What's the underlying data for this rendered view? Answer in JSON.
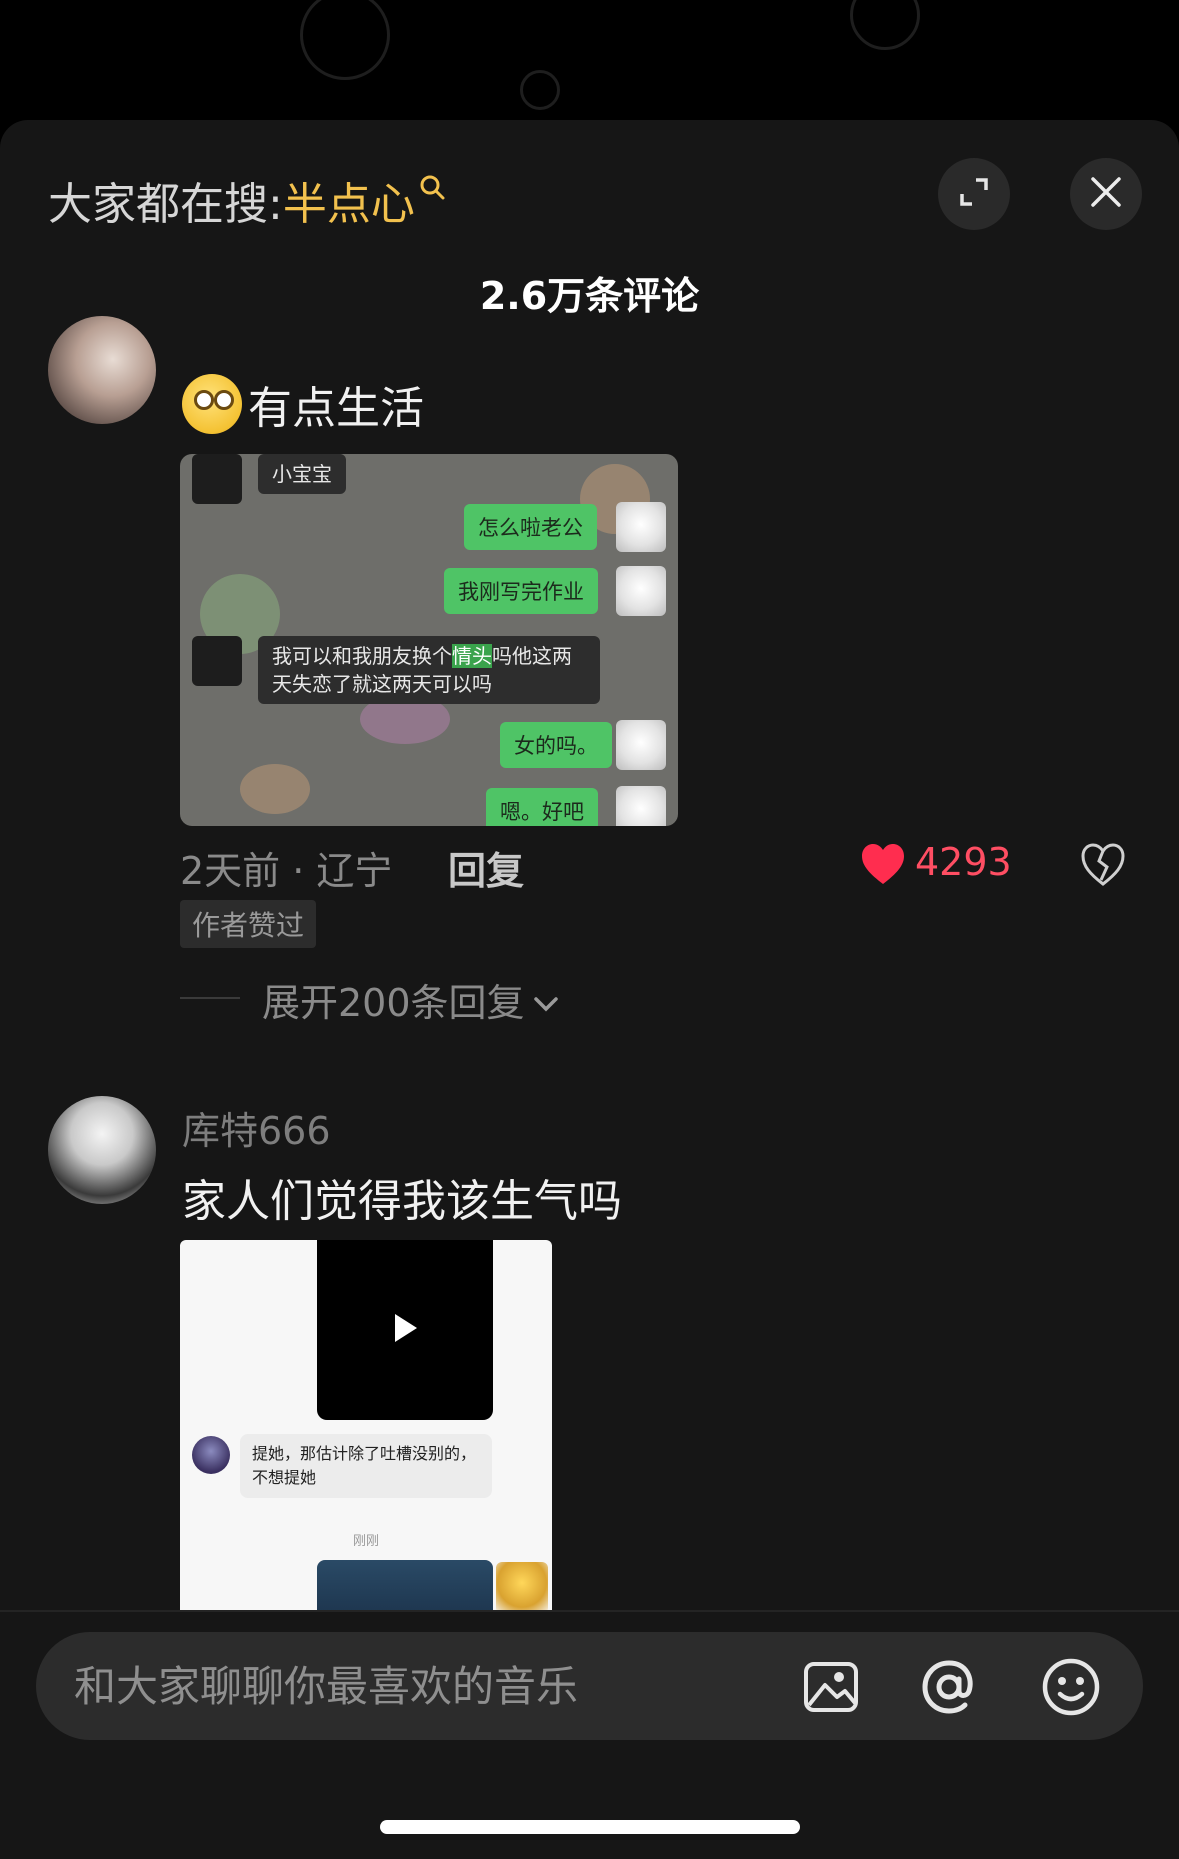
{
  "header": {
    "search_prefix": "大家都在搜:",
    "search_keyword": "半点心",
    "comment_count": "2.6万条评论"
  },
  "icons": {
    "search": "search-icon",
    "expand": "expand-icon",
    "close": "close-icon",
    "heart": "heart-icon",
    "dislike": "broken-heart-icon",
    "chevron": "chevron-down-icon",
    "image": "image-icon",
    "at": "@",
    "emoji": "emoji-icon"
  },
  "colors": {
    "keyword": "#f2c14e",
    "like": "#ff4e63",
    "chat_green": "#4fc466"
  },
  "comment1": {
    "text": "有点生活",
    "screenshot": {
      "contact_name": "小宝宝",
      "messages": [
        {
          "side": "right",
          "text": "怎么啦老公"
        },
        {
          "side": "right",
          "text": "我刚写完作业"
        },
        {
          "side": "left",
          "text_before": "我可以和我朋友换个",
          "highlight": "情头",
          "text_after": "吗他这两天失恋了就这两天可以吗"
        },
        {
          "side": "right",
          "text": "女的吗。"
        },
        {
          "side": "right",
          "text": "嗯。好吧"
        }
      ]
    },
    "time_location": "2天前 · 辽宁",
    "reply_label": "回复",
    "likes": "4293",
    "author_badge": "作者赞过",
    "expand_replies": "展开200条回复"
  },
  "comment2": {
    "username": "库特666",
    "text": "家人们觉得我该生气吗",
    "screenshot": {
      "bubble_text": "提她，那估计除了吐槽没别的，不想提她",
      "timestamp": "刚刚"
    }
  },
  "input": {
    "placeholder": "和大家聊聊你最喜欢的音乐"
  }
}
